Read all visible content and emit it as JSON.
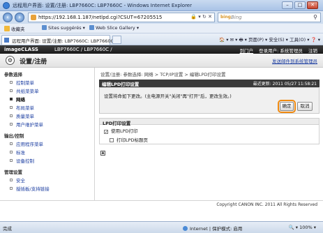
{
  "window": {
    "title": "远程用户界面: 设置/注册: LBP7660C: LBP7660C - Windows Internet Explorer",
    "minimize": "–",
    "maximize": "□",
    "close": "✕"
  },
  "address_bar": {
    "url": "https://192.168.1.187/netlpd.cgi?CSUT=67205515",
    "buttons": "🔒 ▾ ↻ ✕",
    "search_engine": "bing",
    "search_placeholder": "Bing"
  },
  "favorites_bar": {
    "favorites_label": "收藏夹",
    "items": [
      "Sites suggérés ▾",
      "Web Slice Gallery ▾"
    ]
  },
  "tabs": {
    "active_tab_label": "远程用户界面: 设置/注册: LBP7660C: LBP7660C",
    "command_bar": "🏠 ▾  ✉ ▾  🖶 ▾  页面(P) ▾  安全(S) ▾  工具(O) ▾  ❓ ▾"
  },
  "header": {
    "brand": "imageCLASS",
    "model": "LBP7660C / LBP7660C /",
    "links": [
      "到门户",
      "登录用户: 系统管理员",
      "注销"
    ]
  },
  "settings": {
    "title": "设置/注册",
    "mail_link": "发送邮件到系统管理员"
  },
  "sidebar": {
    "sections": [
      {
        "label": "参数选择",
        "items": [
          "控制菜单",
          "共纸菜菜单",
          "网络",
          "布局菜单",
          "质量菜单",
          "用户维护菜单"
        ]
      },
      {
        "label": "输出/控制",
        "items": [
          "应用程序菜单",
          "标准",
          "设备控制"
        ]
      },
      {
        "label": "管理设置",
        "items": [
          "安全",
          "授插板/支持链接"
        ]
      }
    ],
    "active_item": "网络"
  },
  "breadcrumb": "设置/注册: 参数选择: 网络 > TCP/IP设置 > 编辑LPD打印设置",
  "panel": {
    "title": "编辑LPD打印设置",
    "last_updated": "最近更新: 2011 05/27 11:58:21",
    "message": "设置将命如下更改。(主电源开关\"关闭\"再\"打开\"后，更改生效。)",
    "ok_label": "确定",
    "cancel_label": "取消"
  },
  "lpd_section": {
    "title": "LPD打印设置",
    "options": [
      {
        "label": "使用LPD打印",
        "checked": true
      },
      {
        "label": "打印LPD标题页",
        "checked": false
      }
    ]
  },
  "top_icon_glyph": "▲",
  "footer": {
    "copyright": "Copyright CANON INC. 2011 All Rights Reserved"
  },
  "status_bar": {
    "status": "完成",
    "zone": "Internet | 保护模式: 启用",
    "zoom": "🔍 ▾  100% ▾"
  }
}
